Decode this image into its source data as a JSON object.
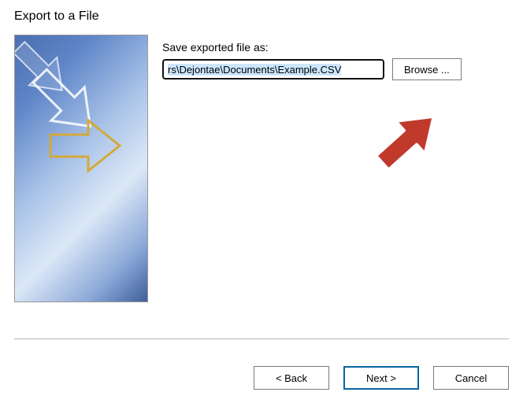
{
  "dialog": {
    "title": "Export to a File"
  },
  "main": {
    "label": "Save exported file as:",
    "file_path": "rs\\Dejontae\\Documents\\Example.CSV",
    "browse_label": "Browse ..."
  },
  "buttons": {
    "back": "< Back",
    "next": "Next >",
    "cancel": "Cancel"
  },
  "annotation": {
    "arrow_color": "#c0392b"
  }
}
